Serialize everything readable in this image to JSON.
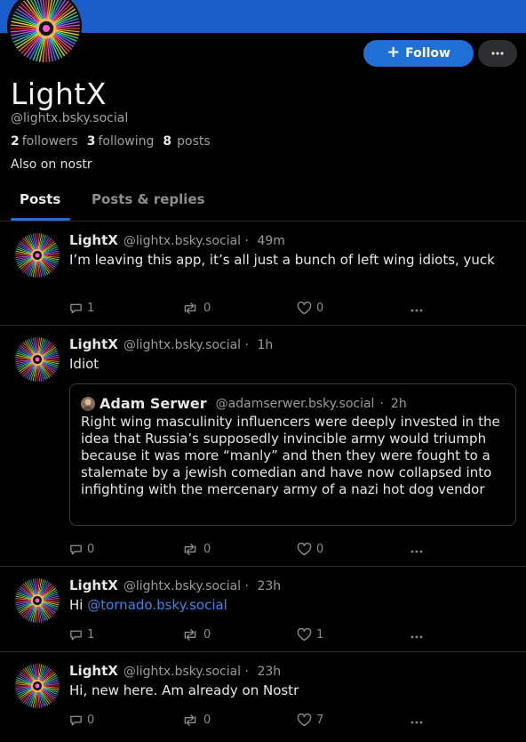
{
  "profile": {
    "display_name": "LightX",
    "handle": "@lightx.bsky.social",
    "followers_count": "2",
    "followers_label": "followers",
    "following_count": "3",
    "following_label": "following",
    "posts_count": "8",
    "posts_label": "posts",
    "bio": "Also on nostr",
    "follow_label": "Follow",
    "more_label": "•••"
  },
  "tabs": [
    {
      "label": "Posts",
      "active": true
    },
    {
      "label": "Posts & replies",
      "active": false
    }
  ],
  "posts": [
    {
      "name": "LightX",
      "handle": "@lightx.bsky.social",
      "sep": "·",
      "time": "49m",
      "text": "I’m leaving this app, it’s all just a bunch of left wing idiots, yuck",
      "replies": "1",
      "reposts": "0",
      "likes": "0"
    },
    {
      "name": "LightX",
      "handle": "@lightx.bsky.social",
      "sep": "·",
      "time": "1h",
      "text": "Idiot",
      "quote": {
        "name": "Adam Serwer",
        "handle": "@adamserwer.bsky.social",
        "sep": "·",
        "time": "2h",
        "text": "Right wing masculinity influencers were deeply invested in the idea that Russia’s supposedly invincible army would triumph because it was more “manly” and then they were fought to a stalemate by a jewish comedian and have now collapsed into infighting with the mercenary army of a nazi hot dog vendor"
      },
      "replies": "0",
      "reposts": "0",
      "likes": "0"
    },
    {
      "name": "LightX",
      "handle": "@lightx.bsky.social",
      "sep": "·",
      "time": "23h",
      "text_prefix": "Hi ",
      "mention": "@tornado.bsky.social",
      "replies": "1",
      "reposts": "0",
      "likes": "1"
    },
    {
      "name": "LightX",
      "handle": "@lightx.bsky.social",
      "sep": "·",
      "time": "23h",
      "text": "Hi, new here. Am already on Nostr",
      "replies": "0",
      "reposts": "0",
      "likes": "7"
    }
  ],
  "colors": {
    "banner": "#1a5fc9",
    "accent": "#1f6fd6",
    "mention": "#3d86e5"
  }
}
